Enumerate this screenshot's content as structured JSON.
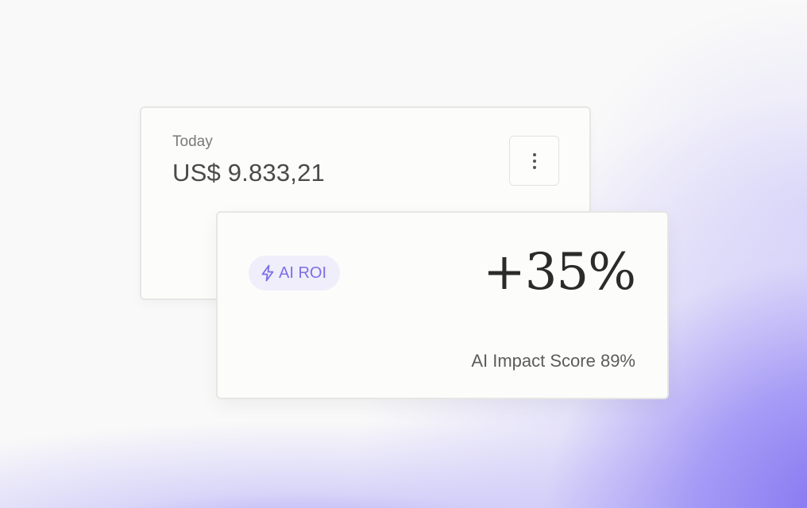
{
  "today_card": {
    "label": "Today",
    "amount": "US$ 9.833,21",
    "menu_icon": "more-vertical-icon"
  },
  "roi_card": {
    "badge_icon": "lightning-bolt-icon",
    "badge_label": "AI ROI",
    "change": "+35%",
    "impact_score": "AI Impact Score 89%"
  },
  "colors": {
    "accent": "#7d6ee6",
    "badge_background": "#efeefa",
    "glow": "#7c6cf0"
  }
}
